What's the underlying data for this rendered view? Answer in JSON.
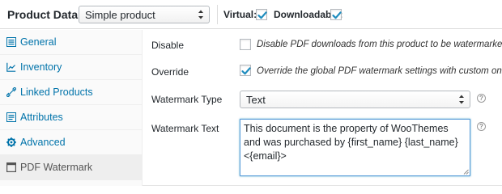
{
  "header": {
    "title": "Product Data —",
    "product_type": "Simple product",
    "virtual_label": "Virtual:",
    "virtual_checked": true,
    "downloadable_label": "Downloadable:",
    "downloadable_checked": true
  },
  "sidebar": {
    "items": [
      {
        "label": "General",
        "icon": "general-icon",
        "active": false
      },
      {
        "label": "Inventory",
        "icon": "inventory-icon",
        "active": false
      },
      {
        "label": "Linked Products",
        "icon": "link-icon",
        "active": false
      },
      {
        "label": "Attributes",
        "icon": "attributes-icon",
        "active": false
      },
      {
        "label": "Advanced",
        "icon": "gear-icon",
        "active": false
      },
      {
        "label": "PDF Watermark",
        "icon": "pdf-icon",
        "active": true
      }
    ]
  },
  "main": {
    "disable": {
      "label": "Disable",
      "checked": false,
      "description": "Disable PDF downloads from this product to be watermarked."
    },
    "override": {
      "label": "Override",
      "checked": true,
      "description": "Override the global PDF watermark settings with custom ones."
    },
    "watermark_type": {
      "label": "Watermark Type",
      "value": "Text"
    },
    "watermark_text": {
      "label": "Watermark Text",
      "value": "This document is the property of WooThemes and was purchased by {first_name} {last_name} <{email}>"
    }
  },
  "colors": {
    "link": "#0073aa",
    "checkmark": "#1e8cbe",
    "focus_border": "#5b9dd9"
  }
}
